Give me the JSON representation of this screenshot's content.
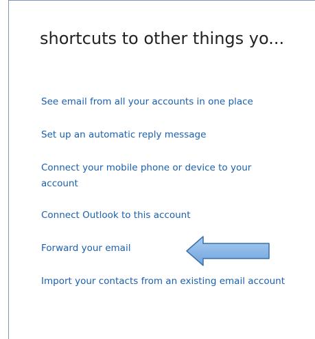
{
  "panel": {
    "title": "shortcuts to other things yo...",
    "links": [
      {
        "label": "See email from all your accounts in one place"
      },
      {
        "label": "Set up an automatic reply message"
      },
      {
        "label": "Connect your mobile phone or device to your account"
      },
      {
        "label": "Connect Outlook to this account"
      },
      {
        "label": "Forward your email"
      },
      {
        "label": "Import your contacts from an existing email account"
      }
    ]
  },
  "annotation": {
    "icon": "arrow-left-icon",
    "fill_color": "#7fb2e8",
    "stroke_color": "#3b6ea8"
  }
}
